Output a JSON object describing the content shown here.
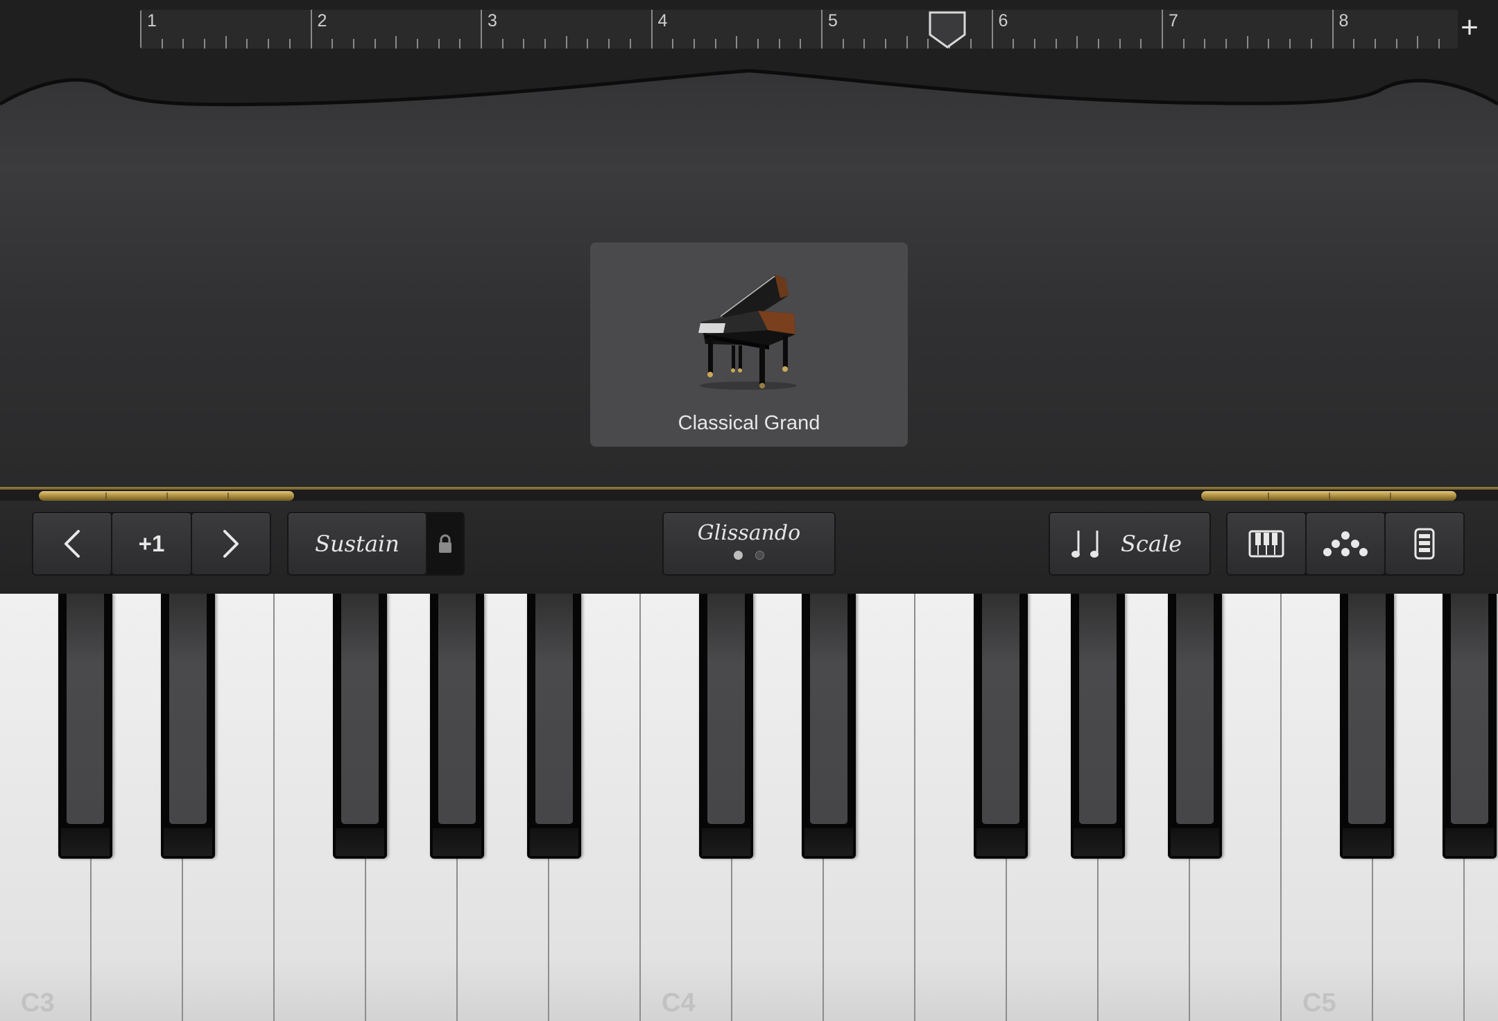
{
  "ruler": {
    "bars": [
      "1",
      "2",
      "3",
      "4",
      "5",
      "6",
      "7",
      "8"
    ],
    "playhead_position_bars": 5.72,
    "add_label": "+"
  },
  "instrument": {
    "name": "Classical Grand",
    "icon": "grand-piano-icon"
  },
  "controls": {
    "octave": {
      "prev_icon": "chevron-left-icon",
      "value": "+1",
      "next_icon": "chevron-right-icon"
    },
    "sustain": {
      "label": "Sustain",
      "lock_icon": "lock-icon"
    },
    "glissando": {
      "label": "Glissando",
      "page_dots": 2,
      "active_dot": 0
    },
    "scale": {
      "notes_icon": "quarter-notes-icon",
      "label": "Scale"
    },
    "view_modes": [
      "keyboard-icon",
      "arpeggiator-dots-icon",
      "keyboard-layout-icon"
    ]
  },
  "keyboard": {
    "octave_labels": [
      "C3",
      "C4",
      "C5"
    ]
  },
  "colors": {
    "gold": "#c9a85a",
    "key_label": "#c2c2c2",
    "background": "#2b2b2c"
  }
}
